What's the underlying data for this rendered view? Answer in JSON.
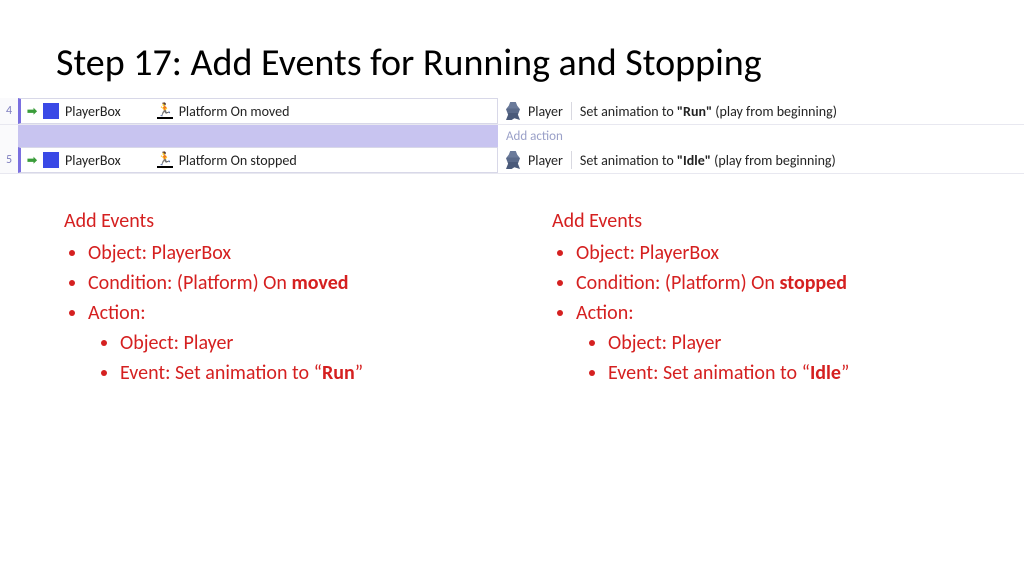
{
  "title": "Step 17: Add Events for Running and Stopping",
  "events": [
    {
      "num": "4",
      "object": "PlayerBox",
      "condition": "Platform On moved",
      "action_object": "Player",
      "action_prefix": "Set animation to ",
      "action_anim": "\"Run\"",
      "action_suffix": " (play from beginning)"
    },
    {
      "num": "5",
      "object": "PlayerBox",
      "condition": "Platform On stopped",
      "action_object": "Player",
      "action_prefix": "Set animation to ",
      "action_anim": "\"Idle\"",
      "action_suffix": " (play from beginning)"
    }
  ],
  "add_action_label": "Add action",
  "notes": {
    "left": {
      "title": "Add Events",
      "object_line": "Object: PlayerBox",
      "cond_prefix": "Condition: (Platform) On ",
      "cond_bold": "moved",
      "action_line": "Action:",
      "sub_object": "Object: Player",
      "sub_event_prefix": "Event: Set animation to “",
      "sub_event_bold": "Run",
      "sub_event_suffix": "”"
    },
    "right": {
      "title": "Add Events",
      "object_line": "Object: PlayerBox",
      "cond_prefix": "Condition: (Platform) On ",
      "cond_bold": "stopped",
      "action_line": "Action:",
      "sub_object": "Object: Player",
      "sub_event_prefix": "Event: Set animation to “",
      "sub_event_bold": "Idle",
      "sub_event_suffix": "”"
    }
  }
}
